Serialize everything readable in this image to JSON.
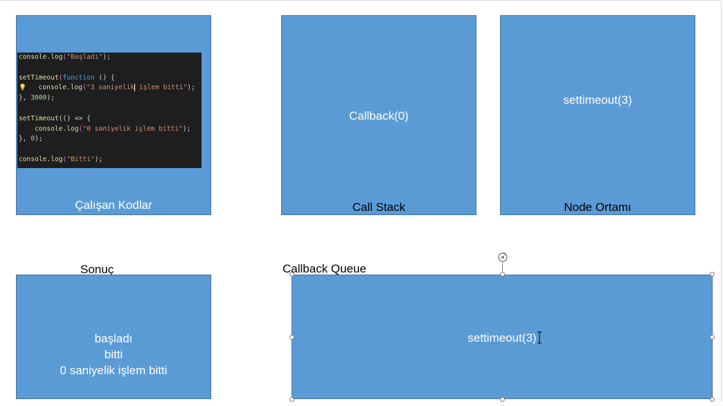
{
  "colors": {
    "box_fill": "#5b9bd5",
    "box_border": "#41719c",
    "code_bg": "#1e1e1e"
  },
  "boxes": {
    "running_code": {
      "label": "Çalışan Kodlar"
    },
    "call_stack": {
      "content": "Callback(0)",
      "label": "Call Stack"
    },
    "node_env": {
      "content": "settimeout(3)",
      "label": "Node Ortamı"
    },
    "result": {
      "heading": "Sonuç",
      "lines": [
        "başladı",
        "bitti",
        "0 saniyelik işlem bitti"
      ]
    },
    "callback_queue": {
      "heading": "Callback Queue",
      "content": "settimeout(3)"
    }
  },
  "code": {
    "line1": {
      "fn": "console.log",
      "str": "\"Başladı\"",
      "end": ");"
    },
    "line3": {
      "fn": "setTimeout",
      "kw": "function",
      "rest": " () {"
    },
    "line4": {
      "fn": "console.log",
      "str_a": "\"3 saniyelik",
      "str_b": " işlem bitti\"",
      "end": ");"
    },
    "line5": {
      "num": "3000",
      "end": ");"
    },
    "line7": {
      "fn": "setTimeout",
      "rest": "(() => {"
    },
    "line8": {
      "fn": "console.log",
      "str": "\"0 saniyelik işlem bitti\"",
      "end": ");"
    },
    "line9": {
      "num": "0",
      "end": ");"
    },
    "line11": {
      "fn": "console.log",
      "str": "\"Bitti\"",
      "end": ");"
    }
  }
}
